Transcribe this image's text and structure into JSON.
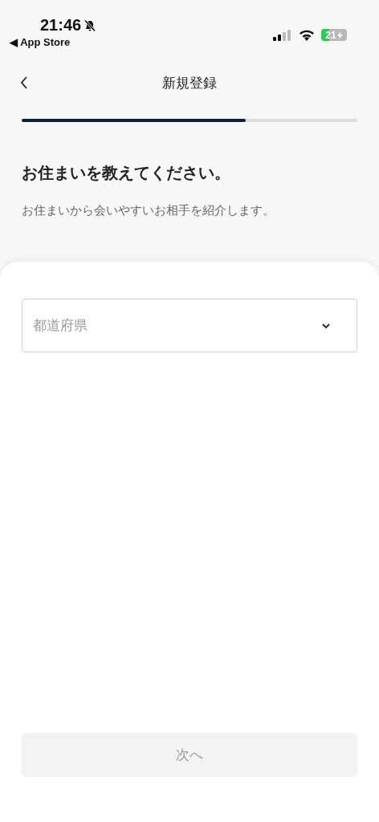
{
  "status_bar": {
    "time": "21:46",
    "back_app": "◀ App Store",
    "battery": "21",
    "silent": true
  },
  "header": {
    "title": "新規登録"
  },
  "progress": {
    "level": 0.667
  },
  "heading": "お住まいを教えてください。",
  "subtitle": "お住まいから会いやすいお相手を紹介します。",
  "prefecture_field": {
    "placeholder": "都道府県"
  },
  "next_button": {
    "label": "次へ",
    "disabled": true
  }
}
